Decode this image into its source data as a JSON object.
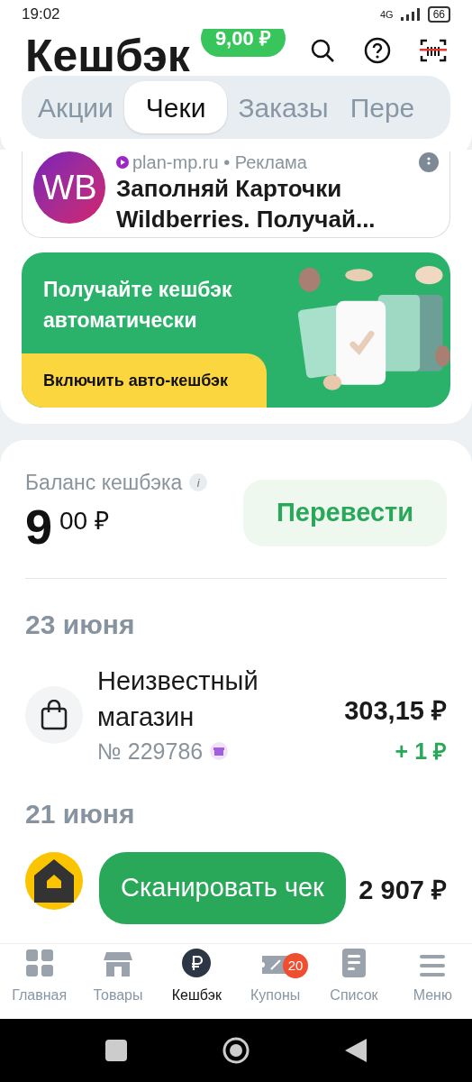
{
  "status_bar": {
    "time": "19:02",
    "network": "4G",
    "battery": "66"
  },
  "header": {
    "title": "Кешбэк",
    "balance_badge": "9,00 ₽"
  },
  "tabs": [
    {
      "label": "Акции",
      "selected": false
    },
    {
      "label": "Чеки",
      "selected": true
    },
    {
      "label": "Заказы",
      "selected": false
    },
    {
      "label": "Пере",
      "selected": false
    }
  ],
  "ad": {
    "logo": "WB",
    "source": "plan-mp.ru • Реклама",
    "title": "Заполняй Карточки Wildberries. Получай..."
  },
  "promo": {
    "title": "Получайте кешбэк автоматически",
    "button": "Включить авто-кешбэк"
  },
  "balance": {
    "label": "Баланс кешбэка",
    "info": "i",
    "rubles": "9",
    "kopecks": "00",
    "currency": "₽",
    "transfer_button": "Перевести"
  },
  "receipt_groups": [
    {
      "date": "23 июня",
      "receipts": [
        {
          "kind": "bag",
          "store": "Неизвестный магазин",
          "number": "№ 229786",
          "gift": true,
          "amount": "303,15 ₽",
          "cashback": "+ 1 ₽"
        }
      ]
    },
    {
      "date": "21 июня",
      "receipts": [
        {
          "kind": "logo",
          "amount": "2 907 ₽"
        }
      ]
    }
  ],
  "scan_button": "Сканировать чек",
  "nav": [
    {
      "label": "Главная",
      "kind": "grid",
      "selected": false
    },
    {
      "label": "Товары",
      "kind": "shop",
      "selected": false
    },
    {
      "label": "Кешбэк",
      "kind": "ruble",
      "selected": true
    },
    {
      "label": "Купоны",
      "kind": "coupon",
      "selected": false,
      "badge": "20"
    },
    {
      "label": "Список",
      "kind": "list",
      "selected": false
    },
    {
      "label": "Меню",
      "kind": "menu",
      "selected": false
    }
  ]
}
